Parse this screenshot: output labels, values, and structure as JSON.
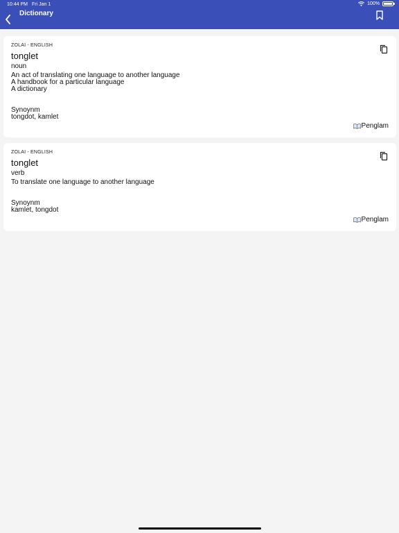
{
  "status_bar": {
    "time": "10:44 PM",
    "date": "Fri Jan 1",
    "battery": "100%"
  },
  "header": {
    "title": "Dictionary"
  },
  "entries": [
    {
      "language_pair": "ZOLAI - ENGLISH",
      "word": "tonglet",
      "part_of_speech": "noun",
      "definitions": [
        "An act of translating one language to another language",
        "A handbook for a particular language",
        "A dictionary"
      ],
      "synonym_label": "Synoynm",
      "synonyms": "tongdot, kamlet",
      "source": "Penglam"
    },
    {
      "language_pair": "ZOLAI - ENGLISH",
      "word": "tonglet",
      "part_of_speech": "verb",
      "definitions": [
        "To translate one language to another language"
      ],
      "synonym_label": "Synoynm",
      "synonyms": "kamlet, tongdot",
      "source": "Penglam"
    }
  ],
  "colors": {
    "header_bg": "#3a4fb8",
    "page_bg": "#f4f4f4",
    "card_bg": "#ffffff"
  }
}
